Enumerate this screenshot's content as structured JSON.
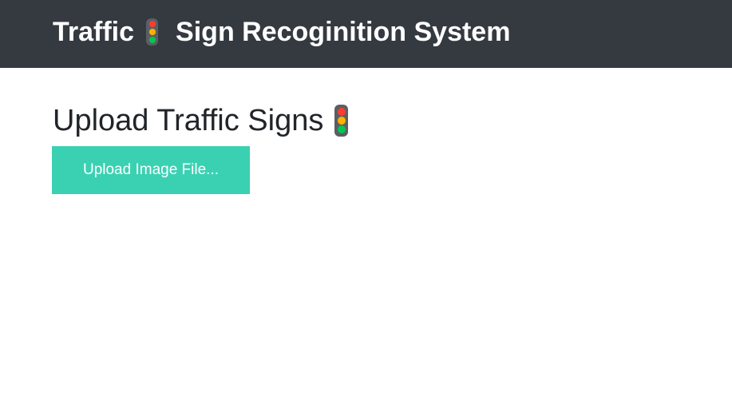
{
  "navbar": {
    "brand_part1": "Traffic",
    "brand_icon": "traffic-light-icon",
    "brand_part2": "Sign Recoginition System",
    "background_color": "#343a40"
  },
  "main": {
    "heading": "Upload Traffic Signs",
    "heading_icon": "traffic-light-icon",
    "upload_button_label": "Upload Image File...",
    "upload_button_color": "#3ad1b2"
  },
  "icon_colors": {
    "red": "#ff3b30",
    "amber": "#ffb300",
    "green": "#00c853",
    "housing": "#5b5f63"
  }
}
